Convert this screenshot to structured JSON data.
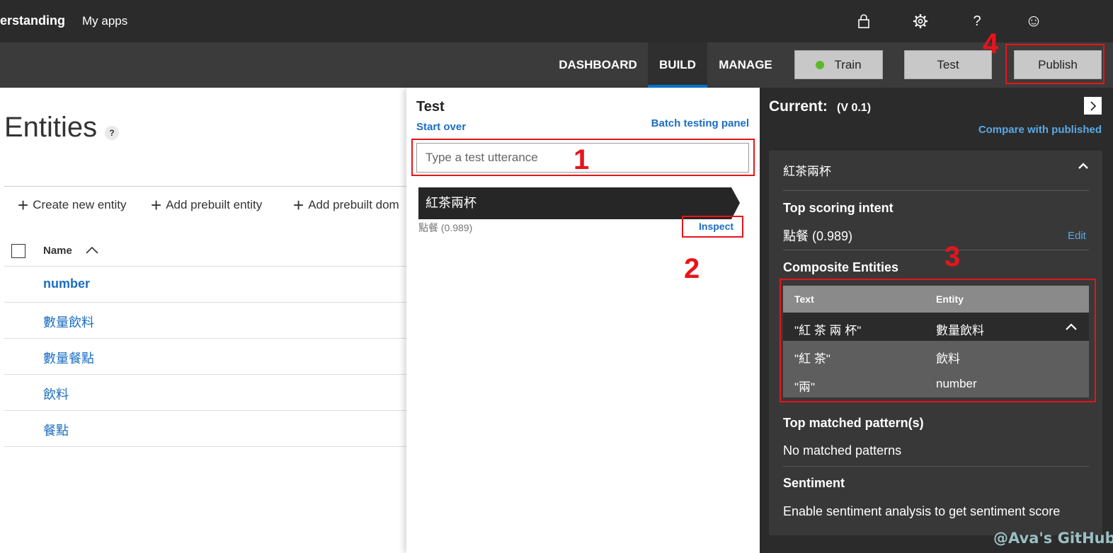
{
  "topbar": {
    "brand": "erstanding",
    "my_apps": "My apps",
    "icons": [
      "lock-icon",
      "gear-icon",
      "help-icon",
      "smiley-icon"
    ],
    "help_glyph": "?",
    "smiley_glyph": "☺"
  },
  "nav": {
    "tabs": [
      {
        "label": "DASHBOARD",
        "active": false
      },
      {
        "label": "BUILD",
        "active": true
      },
      {
        "label": "MANAGE",
        "active": false
      }
    ],
    "train_label": "Train",
    "train_status_color": "#5cb82a",
    "test_label": "Test",
    "publish_label": "Publish",
    "active_tab_color": "#0078d4"
  },
  "entities_page": {
    "title": "Entities",
    "help": "?",
    "toolbar": {
      "create": "Create new entity",
      "add_prebuilt": "Add prebuilt entity",
      "add_domain": "Add prebuilt dom"
    },
    "column_name": "Name",
    "rows": [
      "number",
      "數量飲料",
      "數量餐點",
      "飲料",
      "餐點"
    ]
  },
  "test_panel": {
    "title": "Test",
    "start_over": "Start over",
    "batch_link": "Batch testing panel",
    "input_placeholder": "Type a test utterance",
    "input_value": "",
    "result_utterance": "紅茶兩杯",
    "result_intent": "點餐 (0.989)",
    "inspect_label": "Inspect"
  },
  "inspect_panel": {
    "current_label": "Current:",
    "version": "(V 0.1)",
    "compare_link": "Compare with published",
    "utterance": "紅茶兩杯",
    "top_intent_heading": "Top scoring intent",
    "top_intent_value": "點餐 (0.989)",
    "edit_label": "Edit",
    "composite_heading": "Composite Entities",
    "composite_table": {
      "headers": [
        "Text",
        "Entity"
      ],
      "parent": {
        "text": "\"紅 茶 兩 杯\"",
        "entity": "數量飲料"
      },
      "children": [
        {
          "text": "\"紅 茶\"",
          "entity": "飲料"
        },
        {
          "text": "\"兩\"",
          "entity": "number"
        }
      ]
    },
    "patterns_heading": "Top matched pattern(s)",
    "patterns_value": "No matched patterns",
    "sentiment_heading": "Sentiment",
    "sentiment_value": "Enable sentiment analysis to get sentiment score"
  },
  "annotations": {
    "color": "#e8141b",
    "labels": [
      "1",
      "2",
      "3",
      "4"
    ]
  },
  "watermark": "@Ava's GitHub"
}
